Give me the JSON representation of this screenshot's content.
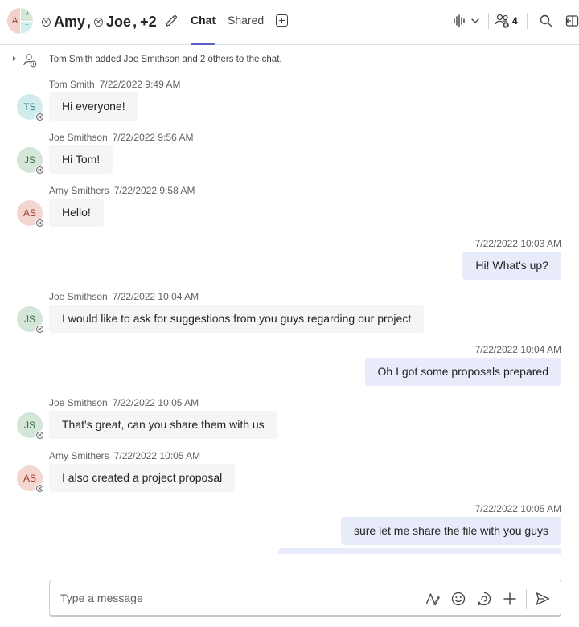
{
  "header": {
    "avatar": {
      "main_initial": "A",
      "small_initial_1": "J",
      "small_initial_2": "T"
    },
    "title": {
      "name1": "Amy",
      "name2": "Joe",
      "sep": ",",
      "more": "+2"
    },
    "tabs": [
      {
        "label": "Chat"
      },
      {
        "label": "Shared"
      }
    ],
    "participants_count": "4",
    "icons": [
      "edit-icon",
      "add-tab-icon",
      "call-icon",
      "chevron-down-icon",
      "people-icon",
      "search-icon",
      "popout-icon"
    ]
  },
  "event": {
    "text": "Tom Smith added Joe Smithson and 2 others to the chat."
  },
  "messages": [
    {
      "sender": "Tom Smith",
      "time": "7/22/2022 9:49 AM",
      "initials": "TS",
      "text": "Hi everyone!"
    },
    {
      "sender": "Joe Smithson",
      "time": "7/22/2022 9:56 AM",
      "initials": "JS",
      "text": "Hi Tom!"
    },
    {
      "sender": "Amy Smithers",
      "time": "7/22/2022 9:58 AM",
      "initials": "AS",
      "text": "Hello!"
    },
    {
      "sender": "",
      "time": "7/22/2022 10:03 AM",
      "initials": "",
      "text": "Hi! What's up?"
    },
    {
      "sender": "Joe Smithson",
      "time": "7/22/2022 10:04 AM",
      "initials": "JS",
      "text": "I would like to ask for suggestions from you guys regarding our project"
    },
    {
      "sender": "",
      "time": "7/22/2022 10:04 AM",
      "initials": "",
      "text": "Oh I got some proposals prepared"
    },
    {
      "sender": "Joe Smithson",
      "time": "7/22/2022 10:05 AM",
      "initials": "JS",
      "text": "That's great, can you share them with us"
    },
    {
      "sender": "Amy Smithers",
      "time": "7/22/2022 10:05 AM",
      "initials": "AS",
      "text": "I also created a project proposal"
    },
    {
      "sender": "",
      "time": "7/22/2022 10:05 AM",
      "initials": "",
      "text": "sure let me share the file with you guys"
    }
  ],
  "compose": {
    "placeholder": "Type a message",
    "buttons": [
      "format-icon",
      "emoji-icon",
      "loop-icon",
      "attach-plus-icon",
      "send-icon"
    ]
  },
  "colors": {
    "accent": "#5b5fc7",
    "incoming_bubble": "#f5f5f5",
    "outgoing_bubble": "#e8ebfa"
  }
}
